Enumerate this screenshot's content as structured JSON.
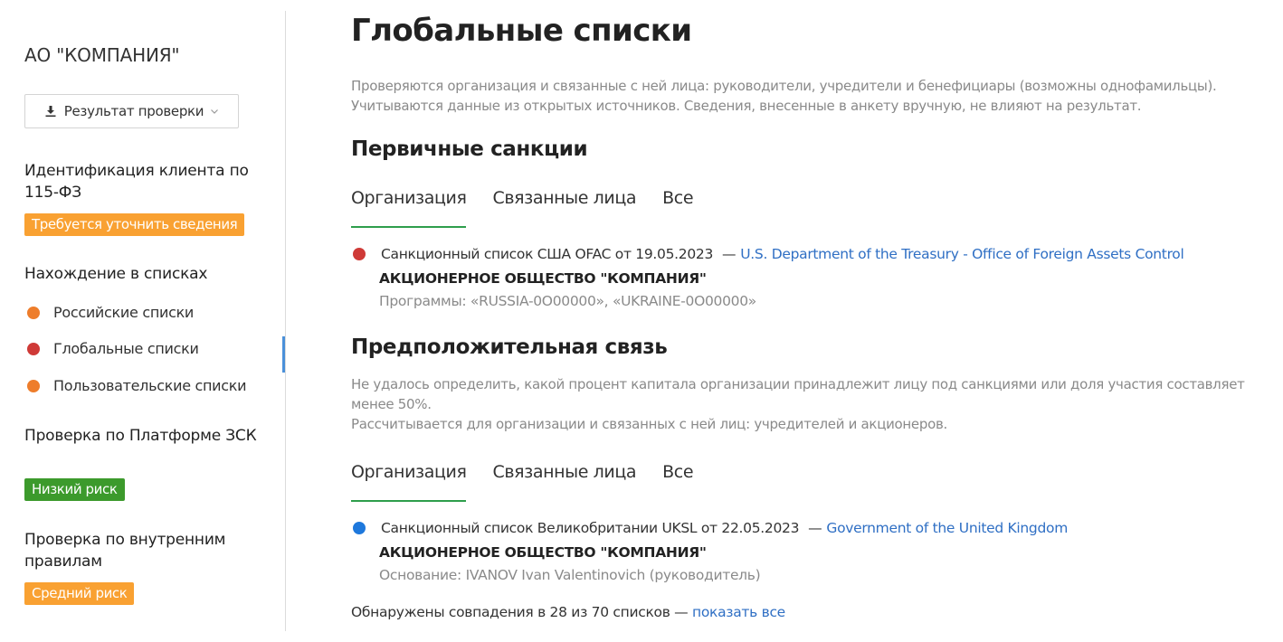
{
  "sidebar": {
    "company_name": "АО \"КОМПАНИЯ\"",
    "result_button": {
      "label": "Результат проверки",
      "icon": "download-icon",
      "dropdown_icon": "chevron-down-icon"
    },
    "identification": {
      "heading": "Идентификация клиента по 115-ФЗ",
      "badge": {
        "label": "Требуется уточнить сведения",
        "color": "#f9a132"
      }
    },
    "lists": {
      "heading": "Нахождение в списках",
      "items": [
        {
          "label": "Российские списки",
          "status_color": "#ee7d2b",
          "active": false
        },
        {
          "label": "Глобальные списки",
          "status_color": "#cf3a37",
          "active": true
        },
        {
          "label": "Пользовательские списки",
          "status_color": "#ee7d2b",
          "active": false
        }
      ]
    },
    "platform_check": {
      "heading": "Проверка по Платформе ЗСК",
      "badge": {
        "label": "Низкий риск",
        "color": "#3c9a2c"
      }
    },
    "internal_check": {
      "heading": "Проверка по внутренним правилам",
      "badge": {
        "label": "Средний риск",
        "color": "#f9a132"
      }
    },
    "active_indicator_color": "#4a90d9"
  },
  "main": {
    "title": "Глобальные списки",
    "description": [
      "Проверяются организация и связанные с ней лица: руководители, учредители и бенефициары (возможны однофамильцы).",
      "Учитываются данные из открытых источников. Сведения, внесенные в анкету вручную, не влияют на результат."
    ],
    "primary_sanctions": {
      "title": "Первичные санкции",
      "tabs": [
        {
          "label": "Организация",
          "active": true
        },
        {
          "label": "Связанные лица",
          "active": false
        },
        {
          "label": "Все",
          "active": false
        }
      ],
      "entries": [
        {
          "status_color": "#cf3a37",
          "list_name": "Санкционный список США OFAC от 19.05.2023",
          "separator": "—",
          "source_link": "U.S. Department of the Treasury - Office of Foreign Assets Control",
          "organization": "АКЦИОНЕРНОЕ ОБЩЕСТВО \"КОМПАНИЯ\"",
          "details": "Программы: «RUSSIA-0O00000», «UKRAINE-0O00000»"
        }
      ]
    },
    "presumed_link": {
      "title": "Предположительная связь",
      "description": [
        "Не удалось определить, какой процент капитала организации принадлежит лицу под санкциями или доля участия составляет",
        "менее 50%.",
        "Рассчитывается для организации и связанных с ней лиц: учредителей и акционеров."
      ],
      "tabs": [
        {
          "label": "Организация",
          "active": true
        },
        {
          "label": "Связанные лица",
          "active": false
        },
        {
          "label": "Все",
          "active": false
        }
      ],
      "entries": [
        {
          "status_color": "#1e78dc",
          "list_name": "Санкционный список Великобритании UKSL от 22.05.2023",
          "separator": "—",
          "source_link": "Government of the United Kingdom",
          "organization": "АКЦИОНЕРНОЕ ОБЩЕСТВО \"КОМПАНИЯ\"",
          "details": "Основание: IVANOV Ivan Valentinovich (руководитель)"
        }
      ]
    },
    "footer": {
      "text": "Обнаружены совпадения в 28 из 70 списков",
      "separator": "—",
      "link": "показать все"
    },
    "accent_colors": {
      "tab_underline": "#2e9e4c",
      "link": "#2f6fc4"
    }
  }
}
